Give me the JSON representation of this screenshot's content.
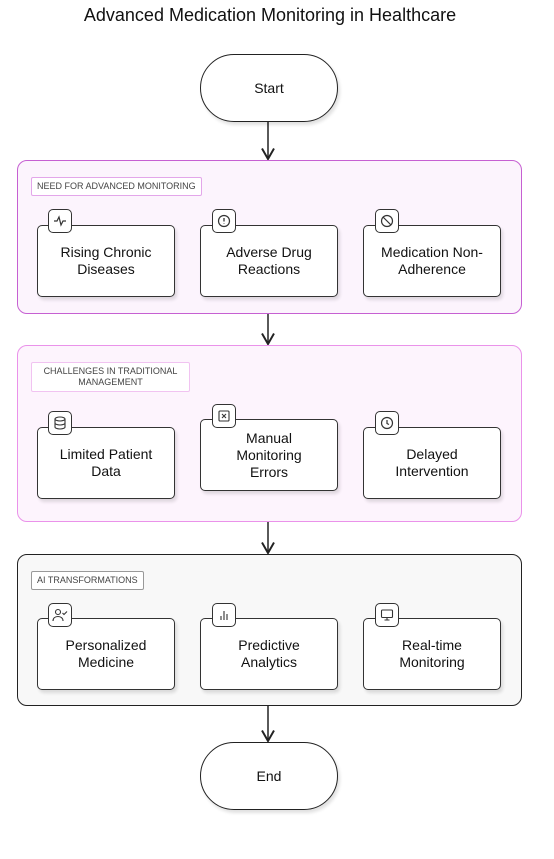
{
  "title": "Advanced Medication Monitoring in Healthcare",
  "start": "Start",
  "end": "End",
  "groups": [
    {
      "label": "NEED FOR ADVANCED MONITORING",
      "border_color": "#c660d2",
      "cards": [
        {
          "text": "Rising Chronic Diseases",
          "icon": "activity-icon"
        },
        {
          "text": "Adverse Drug Reactions",
          "icon": "alert-circle-icon"
        },
        {
          "text": "Medication Non-Adherence",
          "icon": "ban-icon"
        }
      ]
    },
    {
      "label": "CHALLENGES IN TRADITIONAL MANAGEMENT",
      "border_color": "#ea92ea",
      "cards": [
        {
          "text": "Limited Patient Data",
          "icon": "database-icon"
        },
        {
          "text": "Manual Monitoring Errors",
          "icon": "x-square-icon"
        },
        {
          "text": "Delayed Intervention",
          "icon": "clock-icon"
        }
      ]
    },
    {
      "label": "AI TRANSFORMATIONS",
      "border_color": "#222222",
      "cards": [
        {
          "text": "Personalized Medicine",
          "icon": "user-check-icon"
        },
        {
          "text": "Predictive Analytics",
          "icon": "bar-chart-icon"
        },
        {
          "text": "Real-time Monitoring",
          "icon": "monitor-icon"
        }
      ]
    }
  ]
}
